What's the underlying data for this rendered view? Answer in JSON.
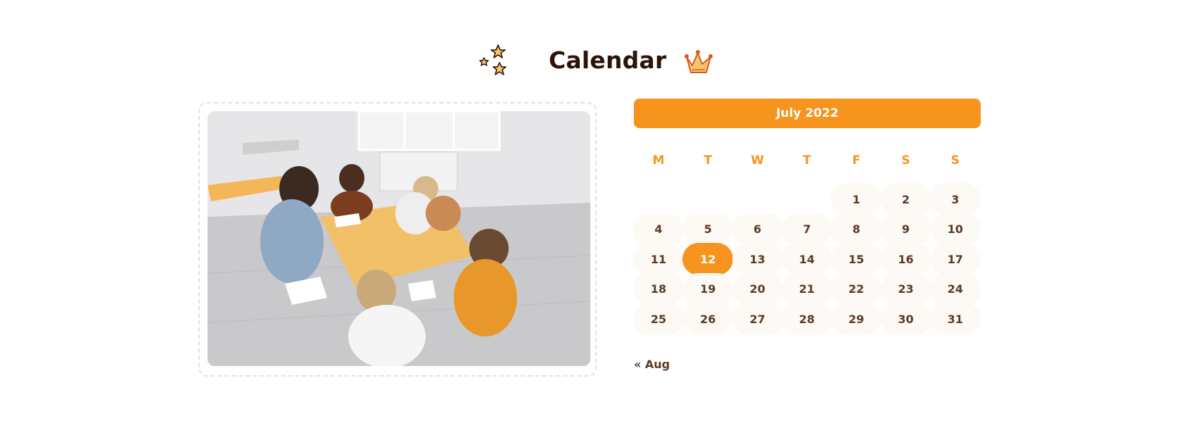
{
  "header": {
    "title": "Calendar",
    "left_icon": "stars-icon",
    "right_icon": "crown-icon"
  },
  "photo": {
    "description_icon": "classroom-photo"
  },
  "calendar": {
    "month_label": "July 2022",
    "weekdays": [
      "M",
      "T",
      "W",
      "T",
      "F",
      "S",
      "S"
    ],
    "weeks": [
      [
        "",
        "",
        "",
        "",
        "1",
        "2",
        "3"
      ],
      [
        "4",
        "5",
        "6",
        "7",
        "8",
        "9",
        "10"
      ],
      [
        "11",
        "12",
        "13",
        "14",
        "15",
        "16",
        "17"
      ],
      [
        "18",
        "19",
        "20",
        "21",
        "22",
        "23",
        "24"
      ],
      [
        "25",
        "26",
        "27",
        "28",
        "29",
        "30",
        "31"
      ]
    ],
    "today": "12",
    "prev_label": "« Aug"
  },
  "colors": {
    "accent": "#f7941d",
    "text": "#5a3a25",
    "title": "#2b1409",
    "day_bg": "#fdf9f4"
  }
}
